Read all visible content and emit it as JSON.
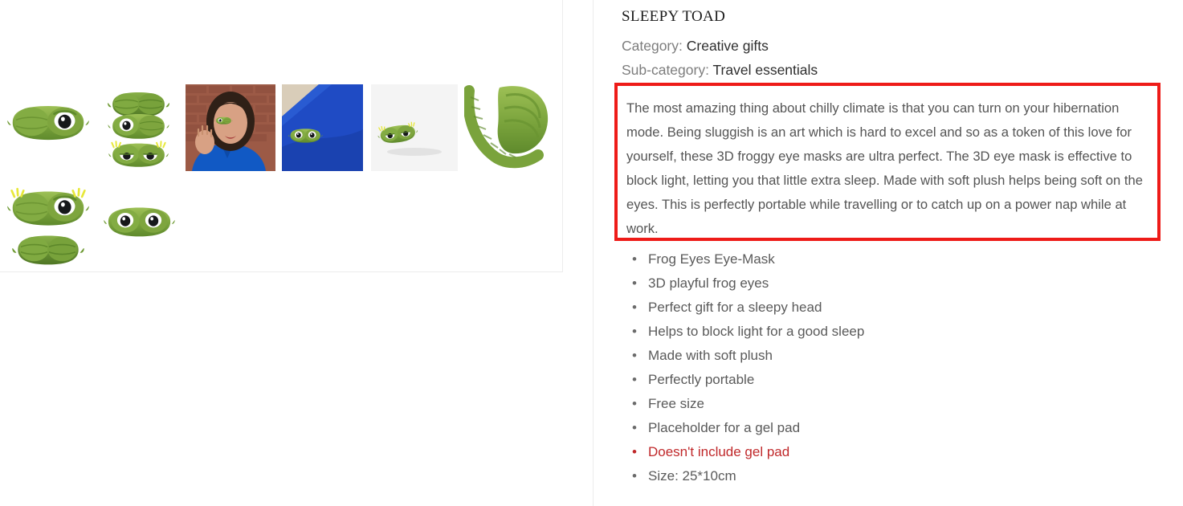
{
  "product": {
    "title": "SLEEPY TOAD",
    "category_label": "Category:",
    "category_value": "Creative gifts",
    "subcategory_label": "Sub-category:",
    "subcategory_value": "Travel essentials",
    "description": "The most amazing thing about chilly climate is that you can turn on your hibernation mode. Being sluggish is an art which is hard to excel and so as a token of this love for yourself, these 3D froggy eye masks are ultra perfect. The 3D eye mask is effective to block light, letting you that little extra sleep. Made with soft plush helps being soft on the eyes. This is perfectly portable while travelling or to catch up on a power nap while at work.",
    "bullet_glyph": "•",
    "features": [
      {
        "text": "Frog Eyes Eye-Mask",
        "highlight": false
      },
      {
        "text": "3D playful frog eyes",
        "highlight": false
      },
      {
        "text": "Perfect gift for a sleepy head",
        "highlight": false
      },
      {
        "text": "Helps to block light for a good sleep",
        "highlight": false
      },
      {
        "text": "Made with soft plush",
        "highlight": false
      },
      {
        "text": "Perfectly portable",
        "highlight": false
      },
      {
        "text": "Free size",
        "highlight": false
      },
      {
        "text": "Placeholder for a gel pad",
        "highlight": false
      },
      {
        "text": "Doesn't include gel pad",
        "highlight": true
      },
      {
        "text": "Size: 25*10cm",
        "highlight": false
      }
    ]
  },
  "gallery": {
    "images": [
      {
        "name": "product-image-mask-front-large",
        "alt": "Green frog eye mask front view, large"
      },
      {
        "name": "product-image-mask-row-top",
        "alt": "Frog eye mask closed eyes small"
      },
      {
        "name": "product-image-mask-row-middle",
        "alt": "Frog eye mask one open eye"
      },
      {
        "name": "product-image-mask-row-bottom",
        "alt": "Frog eye mask sleepy eyes with yellow tufts"
      },
      {
        "name": "product-image-model-wearing-mask",
        "alt": "Woman wearing frog eye mask against brick wall"
      },
      {
        "name": "product-image-mask-on-blue-fabric",
        "alt": "Frog eye mask lying on blue fabric"
      },
      {
        "name": "product-image-mask-angled-white",
        "alt": "Frog eye mask angled on white background"
      },
      {
        "name": "product-image-mask-with-strap",
        "alt": "Frog eye mask showing elastic strap"
      },
      {
        "name": "product-image-mask-tufts-large",
        "alt": "Frog eye mask with yellow tufts, large"
      },
      {
        "name": "product-image-mask-back-large",
        "alt": "Frog eye mask back view, large"
      },
      {
        "name": "product-image-mask-wide-eyes",
        "alt": "Frog eye mask wide open eyes"
      }
    ]
  },
  "colors": {
    "accent_red": "#ee1b18",
    "warning_text": "#c0282a",
    "body_text": "#545454",
    "muted_text": "#7d7d7d",
    "title_text": "#1b1b1b",
    "mask_green": "#7aa33c",
    "mask_green_dark": "#5f8a2c",
    "mask_green_light": "#9dc055",
    "brick": "#9c5a46",
    "blue_fabric": "#1f4bc4",
    "shirt_blue": "#1159c4",
    "skin": "#d8a184",
    "hair": "#2f2017"
  }
}
